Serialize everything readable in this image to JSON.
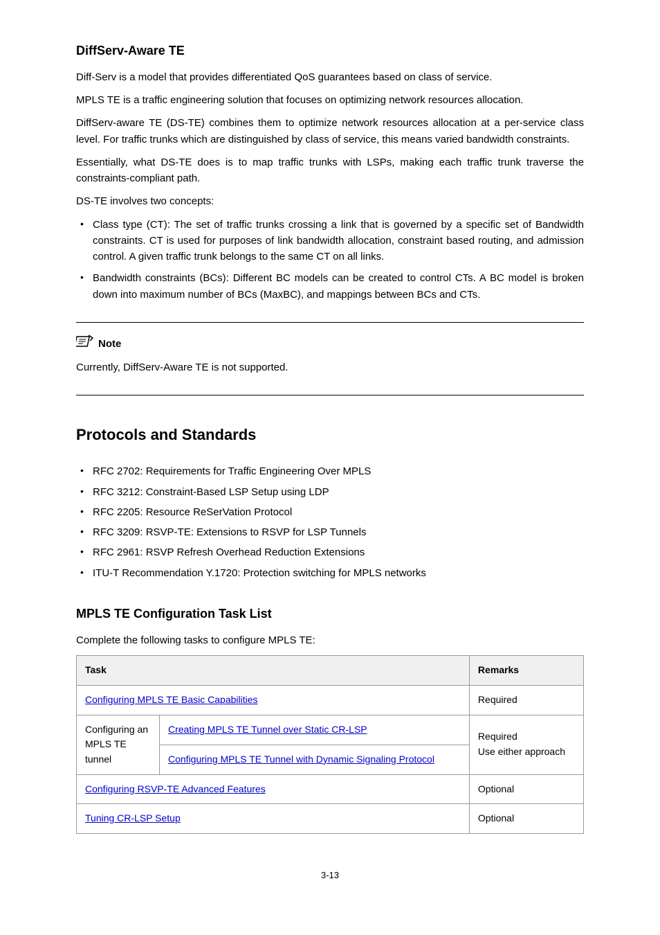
{
  "diffserv": {
    "title": "DiffServ-Aware TE",
    "p1": "Diff-Serv is a model that provides differentiated QoS guarantees based on class of service.",
    "p2": "MPLS TE is a traffic engineering solution that focuses on optimizing network resources allocation.",
    "p3": "DiffServ-aware TE (DS-TE) combines them to optimize network resources allocation at a per-service class level. For traffic trunks which are distinguished by class of service, this means varied bandwidth constraints.",
    "p4": "Essentially, what DS-TE does is to map traffic trunks with LSPs, making each traffic trunk traverse the constraints-compliant path.",
    "p5": "DS-TE involves two concepts:",
    "bullets": [
      "Class type (CT): The set of traffic trunks crossing a link that is governed by a specific set of Bandwidth constraints. CT is used for purposes of link bandwidth allocation, constraint based routing, and admission control. A given traffic trunk belongs to the same CT on all links.",
      "Bandwidth constraints (BCs): Different BC models can be created to control CTs. A BC model is broken down into maximum number of BCs (MaxBC), and mappings between BCs and CTs."
    ]
  },
  "note": {
    "label": "Note",
    "text": "Currently, DiffServ-Aware TE is not supported."
  },
  "protocols": {
    "title": "Protocols and Standards",
    "items": [
      "RFC 2702: Requirements for Traffic Engineering Over MPLS",
      "RFC 3212: Constraint-Based LSP Setup using LDP",
      "RFC 2205: Resource ReSerVation Protocol",
      "RFC 3209: RSVP-TE: Extensions to RSVP for LSP Tunnels",
      "RFC 2961: RSVP Refresh Overhead Reduction Extensions",
      "ITU-T Recommendation Y.1720: Protection switching for MPLS networks"
    ]
  },
  "tasklist": {
    "title": "MPLS TE Configuration Task List",
    "intro": "Complete the following tasks to configure MPLS TE:",
    "headers": {
      "task": "Task",
      "remarks": "Remarks"
    },
    "rows": {
      "r1_task": "Configuring MPLS TE Basic Capabilities",
      "r1_remark": "Required",
      "r2_group": "Configuring an MPLS TE tunnel",
      "r2a_task": "Creating MPLS TE Tunnel over Static CR-LSP",
      "r2b_task": "Configuring MPLS TE Tunnel with Dynamic Signaling Protocol",
      "r2_remark_top": "Required",
      "r2_remark_bot": "Use either approach",
      "r3_task": "Configuring RSVP-TE Advanced Features",
      "r3_remark": "Optional",
      "r4_task": "Tuning CR-LSP Setup",
      "r4_remark": "Optional"
    }
  },
  "page_num": "3-13"
}
